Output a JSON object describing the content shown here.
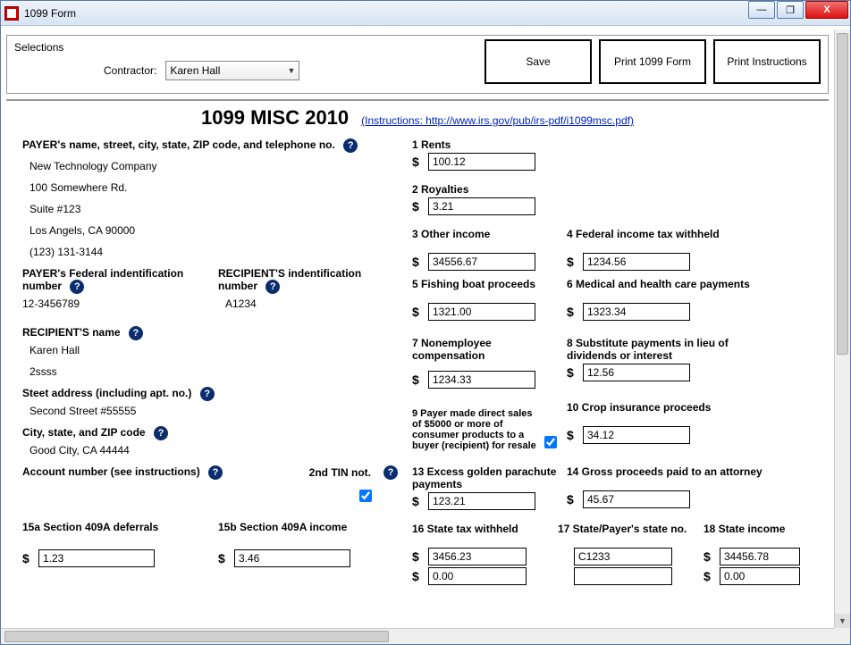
{
  "window": {
    "title": "1099 Form"
  },
  "wincontrols": {
    "minimize": "—",
    "maximize": "❐",
    "close": "X"
  },
  "top": {
    "selections_label": "Selections",
    "contractor_label": "Contractor:",
    "contractor_value": "Karen Hall",
    "btn_save": "Save",
    "btn_print_form": "Print 1099 Form",
    "btn_print_instr": "Print Instructions"
  },
  "header": {
    "title": "1099 MISC 2010",
    "instructions_link": "(Instructions: http://www.irs.gov/pub/irs-pdf/i1099msc.pdf)"
  },
  "payer": {
    "label": "PAYER's name, street, city, state, ZIP code, and telephone no.",
    "name": "New Technology Company",
    "street": "100 Somewhere Rd.",
    "suite": "Suite #123",
    "citystate": "Los Angels, CA 90000",
    "phone": "(123) 131-3144"
  },
  "ids": {
    "payer_fed_label": "PAYER's Federal indentification number",
    "payer_fed_value": "12-3456789",
    "recip_id_label": "RECIPIENT'S indentification number",
    "recip_id_value": "A1234"
  },
  "recipient": {
    "name_label": "RECIPIENT'S name",
    "name": "Karen Hall",
    "extra": "2ssss",
    "street_label": "Steet address (including apt. no.)",
    "street_value": "Second Street #55555",
    "city_label": "City, state, and ZIP code",
    "city_value": "Good City, CA 44444",
    "account_label": "Account number (see instructions)",
    "second_tin_label": "2nd TIN not."
  },
  "boxes": {
    "b1": {
      "label": "1   Rents",
      "value": "100.12"
    },
    "b2": {
      "label": "2   Royalties",
      "value": "3.21"
    },
    "b3": {
      "label": "3   Other income",
      "value": "34556.67"
    },
    "b4": {
      "label": "4   Federal income tax withheld",
      "value": "1234.56"
    },
    "b5": {
      "label": "5   Fishing boat proceeds",
      "value": "1321.00"
    },
    "b6": {
      "label": "6   Medical and health care payments",
      "value": "1323.34"
    },
    "b7": {
      "label": "7   Nonemployee compensation",
      "value": "1234.33"
    },
    "b8": {
      "label": "8   Substitute payments in lieu of dividends or interest",
      "value": "12.56"
    },
    "b9": {
      "label": "9  Payer made direct sales of $5000 or more of consumer products to a buyer (recipient) for resale"
    },
    "b10": {
      "label": "10   Crop insurance proceeds",
      "value": "34.12"
    },
    "b13": {
      "label": "13   Excess golden parachute payments",
      "value": "123.21"
    },
    "b14": {
      "label": "14   Gross proceeds paid to an attorney",
      "value": "45.67"
    },
    "b15a": {
      "label": "15a Section 409A deferrals",
      "value": "1.23"
    },
    "b15b": {
      "label": "15b Section 409A income",
      "value": "3.46"
    },
    "b16": {
      "label": "16   State tax withheld",
      "value1": "3456.23",
      "value2": "0.00"
    },
    "b17": {
      "label": "17   State/Payer's state no.",
      "value1": "C1233",
      "value2": ""
    },
    "b18": {
      "label": "18   State income",
      "value1": "34456.78",
      "value2": "0.00"
    }
  },
  "help": "?"
}
